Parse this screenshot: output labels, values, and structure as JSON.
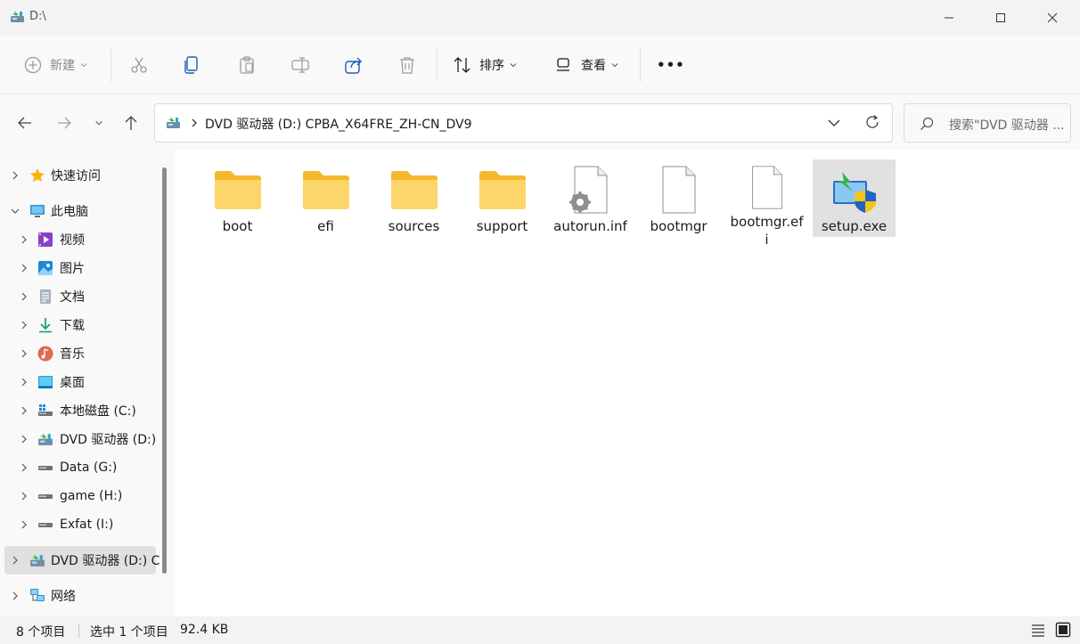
{
  "window": {
    "title": "D:\\"
  },
  "toolbar": {
    "new_label": "新建",
    "sort_label": "排序",
    "view_label": "查看",
    "more_label": "•••"
  },
  "address": {
    "path": "DVD 驱动器 (D:) CPBA_X64FRE_ZH-CN_DV9",
    "search_placeholder": "搜索\"DVD 驱动器 ..."
  },
  "sidebar": {
    "items": [
      {
        "label": "快速访问",
        "icon": "star-icon"
      },
      {
        "label": "此电脑",
        "icon": "computer-icon"
      },
      {
        "label": "视频",
        "icon": "video-icon"
      },
      {
        "label": "图片",
        "icon": "picture-icon"
      },
      {
        "label": "文档",
        "icon": "document-icon"
      },
      {
        "label": "下载",
        "icon": "download-icon"
      },
      {
        "label": "音乐",
        "icon": "music-icon"
      },
      {
        "label": "桌面",
        "icon": "desktop-icon"
      },
      {
        "label": "本地磁盘 (C:)",
        "icon": "local-disk-icon"
      },
      {
        "label": "DVD 驱动器 (D:)",
        "icon": "dvd-drive-icon"
      },
      {
        "label": "Data (G:)",
        "icon": "drive-icon"
      },
      {
        "label": "game (H:)",
        "icon": "drive-icon"
      },
      {
        "label": "Exfat (I:)",
        "icon": "drive-icon"
      },
      {
        "label": "DVD 驱动器 (D:) C",
        "icon": "dvd-drive-icon"
      },
      {
        "label": "网络",
        "icon": "network-icon"
      }
    ]
  },
  "files": [
    {
      "name": "boot",
      "type": "folder"
    },
    {
      "name": "efi",
      "type": "folder"
    },
    {
      "name": "sources",
      "type": "folder"
    },
    {
      "name": "support",
      "type": "folder"
    },
    {
      "name": "autorun.inf",
      "type": "settings-file"
    },
    {
      "name": "bootmgr",
      "type": "file"
    },
    {
      "name": "bootmgr.efi",
      "type": "file"
    },
    {
      "name": "setup.exe",
      "type": "setup-exe"
    }
  ],
  "status": {
    "item_count": "8 个项目",
    "selected": "选中 1 个项目",
    "size": "92.4 KB"
  },
  "colors": {
    "folder": "#f8c83c",
    "folder_light": "#fde08a",
    "accent": "#0067c0",
    "selection": "#e1e1e1"
  }
}
